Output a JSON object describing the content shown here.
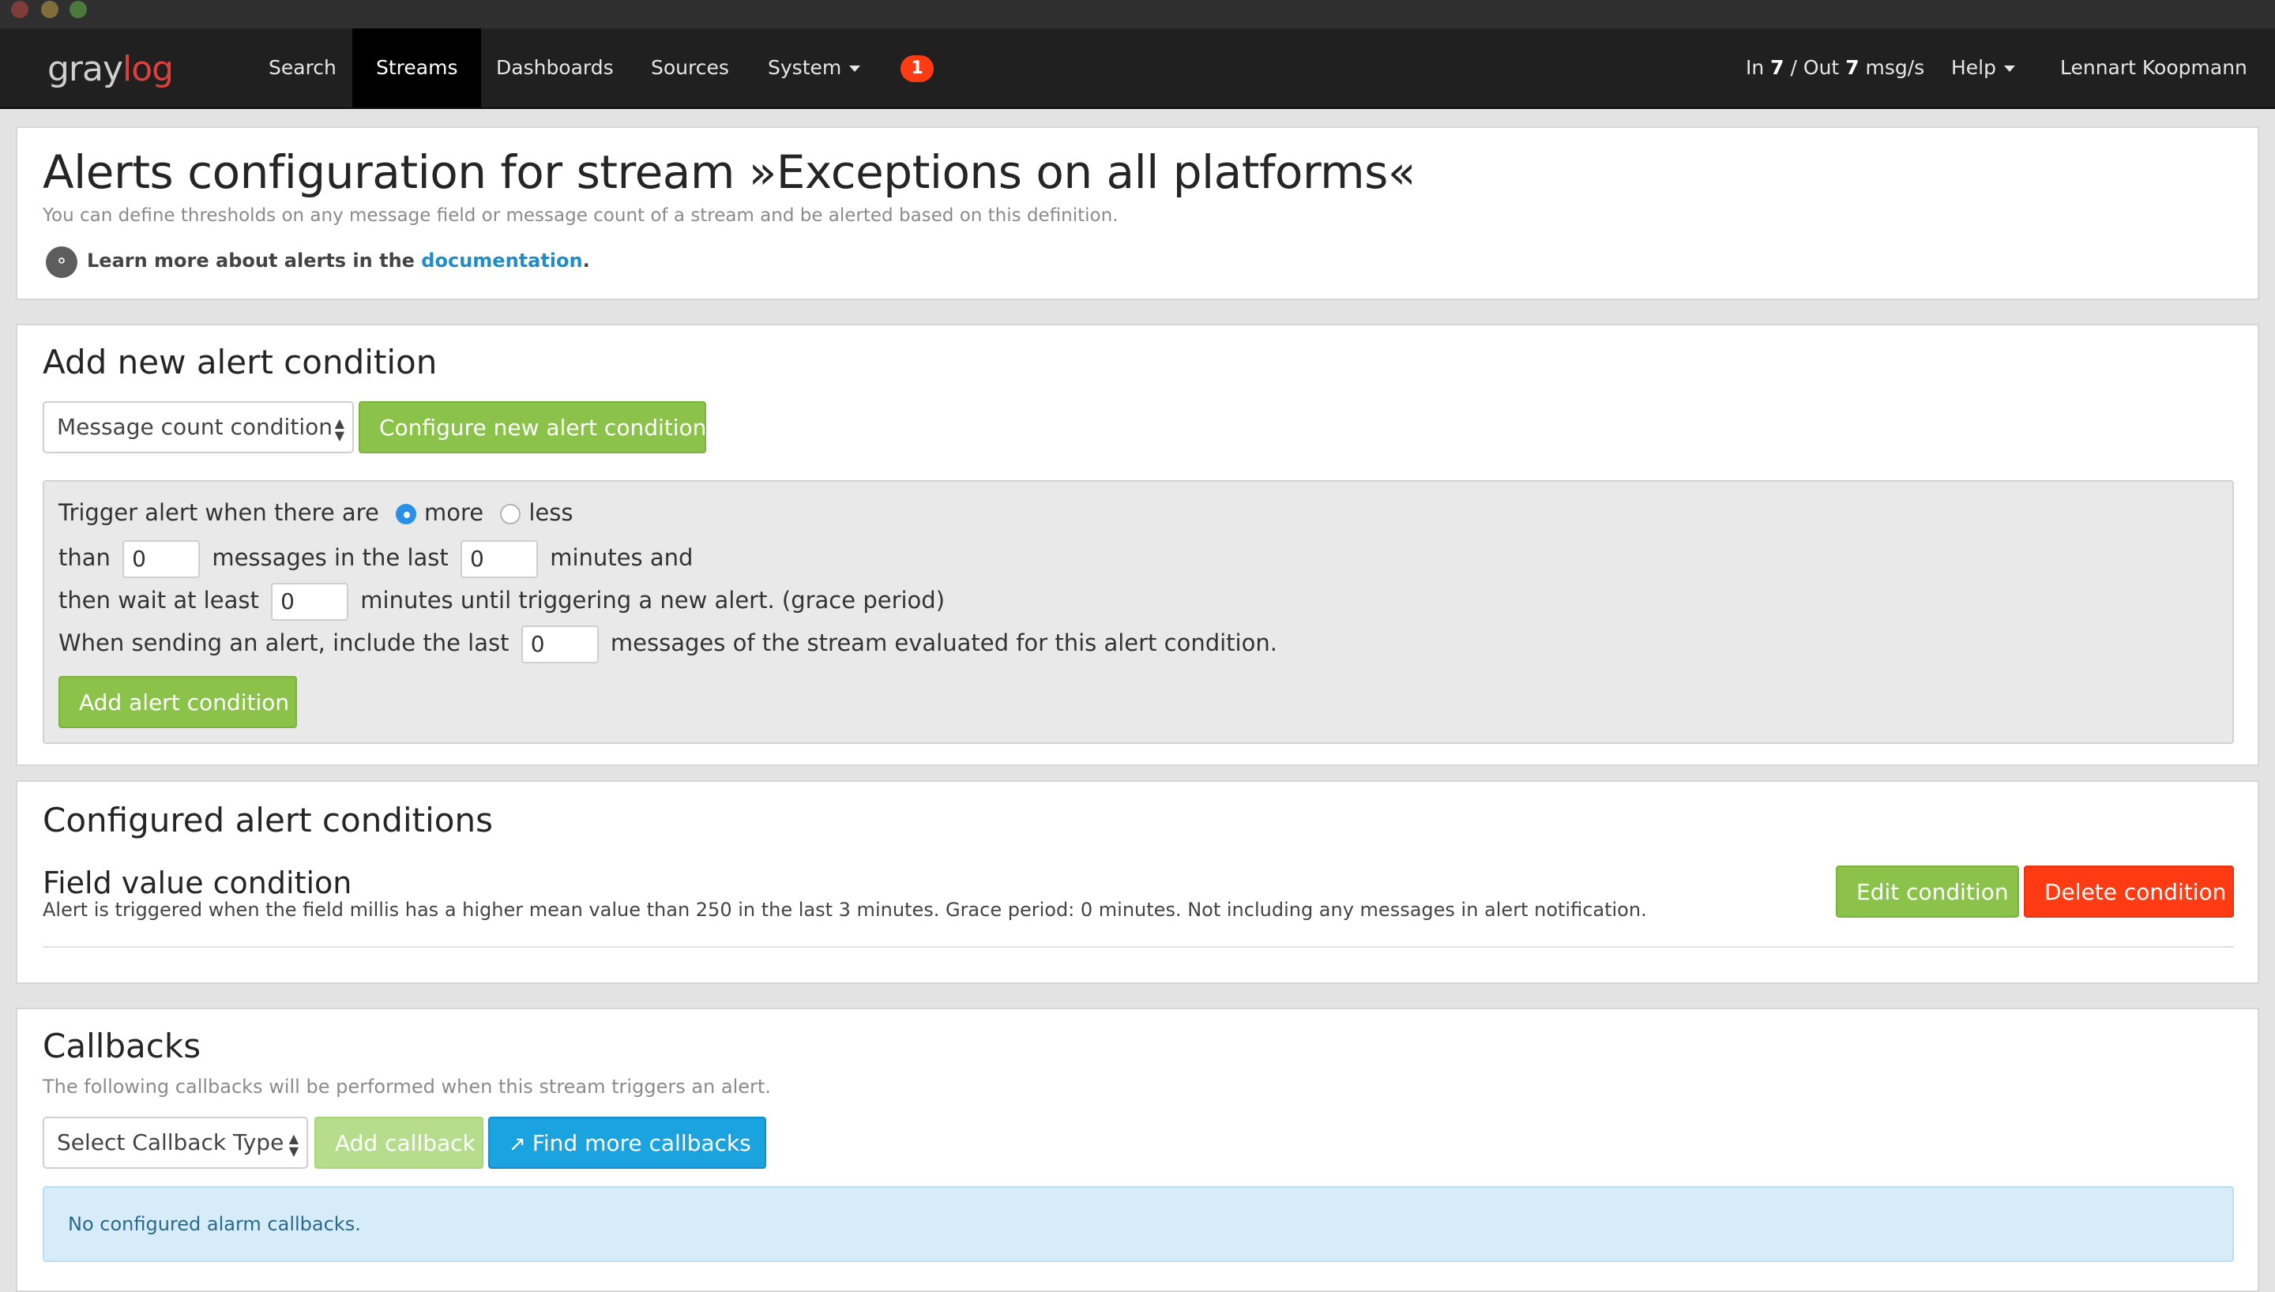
{
  "nav": {
    "logo_gray": "gray",
    "logo_log": "log",
    "items": [
      {
        "label": "Search"
      },
      {
        "label": "Streams"
      },
      {
        "label": "Dashboards"
      },
      {
        "label": "Sources"
      },
      {
        "label": "System"
      }
    ],
    "notification_count": "1",
    "throughput_in_label": "In",
    "throughput_in_value": "7",
    "throughput_out_label": "/ Out",
    "throughput_out_value": "7",
    "throughput_unit": "msg/s",
    "help_label": "Help",
    "user_label": "Lennart Koopmann"
  },
  "header": {
    "title": "Alerts configuration for stream »Exceptions on all platforms«",
    "subtitle": "You can define thresholds on any message field or message count of a stream and be alerted based on this definition.",
    "learn_prefix": "Learn more about alerts in the",
    "learn_link": "documentation",
    "learn_suffix": "."
  },
  "add_condition": {
    "title": "Add new alert condition",
    "select_value": "Message count condition",
    "configure_button": "Configure new alert condition",
    "form": {
      "line1_prefix": "Trigger alert when there are",
      "option_more": "more",
      "option_less": "less",
      "selected": "more",
      "line2_than": "than",
      "line2_messages": "messages in the last",
      "line2_minutes": "minutes and",
      "line3_prefix": "then wait at least",
      "line3_suffix": "minutes until triggering a new alert. (grace period)",
      "line4_prefix": "When sending an alert, include the last",
      "line4_suffix": "messages of the stream evaluated for this alert condition.",
      "threshold_value": "0",
      "time_value": "0",
      "grace_value": "0",
      "backlog_value": "0"
    },
    "add_button": "Add alert condition"
  },
  "configured": {
    "title": "Configured alert conditions",
    "conditions": [
      {
        "title": "Field value condition",
        "description": "Alert is triggered when the field millis has a higher mean value than 250 in the last 3 minutes. Grace period: 0 minutes. Not including any messages in alert notification.",
        "edit_label": "Edit condition",
        "delete_label": "Delete condition"
      }
    ]
  },
  "callbacks": {
    "title": "Callbacks",
    "subtitle": "The following callbacks will be performed when this stream triggers an alert.",
    "select_value": "Select Callback Type",
    "add_button": "Add callback",
    "find_button": "Find more callbacks",
    "empty_message": "No configured alarm callbacks."
  },
  "colors": {
    "primary_green": "#8bc34a",
    "danger_red": "#ff3b13",
    "info_blue": "#1ba3e0",
    "navbar": "#202020"
  }
}
